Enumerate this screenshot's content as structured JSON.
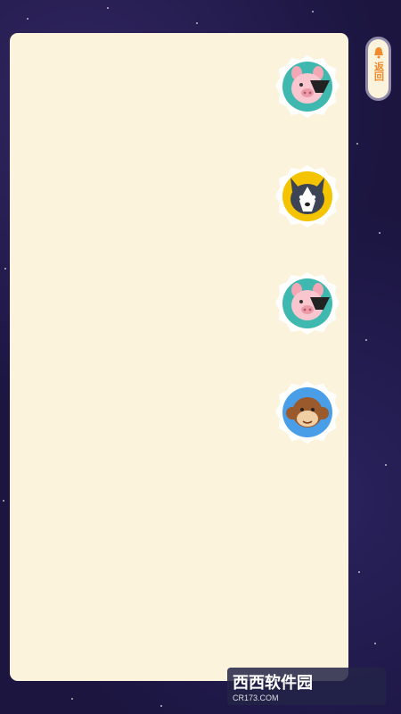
{
  "back_button": {
    "label": "返回",
    "icon": "bell-icon"
  },
  "tiles": [
    {
      "animal": "pig",
      "badge_color": "#3fb8b0",
      "icon": "pig-icon"
    },
    {
      "animal": "husky",
      "badge_color": "#f4c400",
      "icon": "husky-icon"
    },
    {
      "animal": "pig",
      "badge_color": "#3fb8b0",
      "icon": "pig-icon"
    },
    {
      "animal": "monkey",
      "badge_color": "#4a9ee8",
      "icon": "monkey-icon"
    }
  ],
  "watermark": {
    "brand": "西西软件园",
    "url": "CR173.COM"
  }
}
